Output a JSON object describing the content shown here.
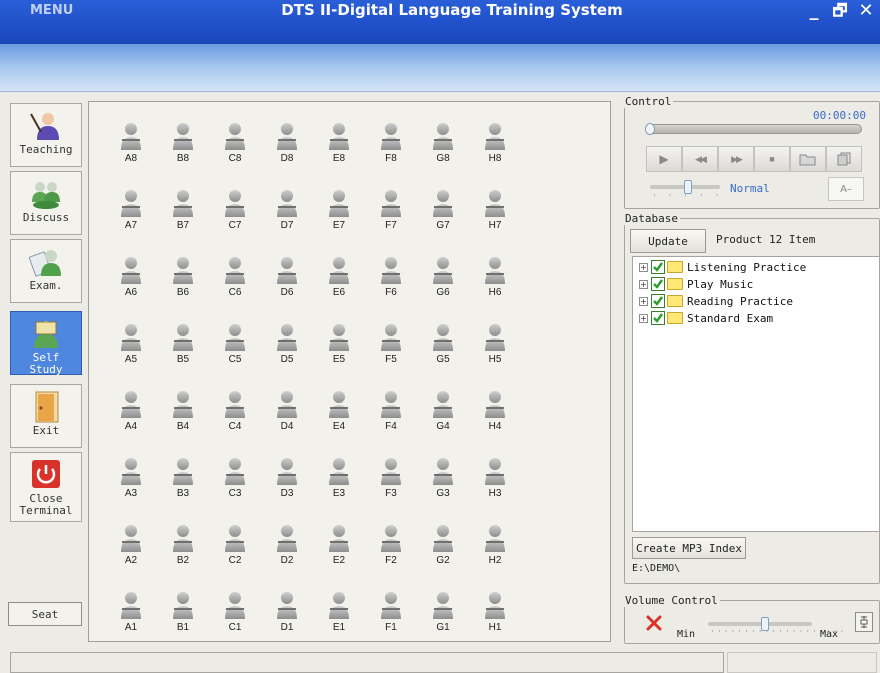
{
  "window": {
    "menu_label": "MENU",
    "title": "DTS II-Digital Language Training System",
    "controls": {
      "minimize": "_",
      "restore": "🗗",
      "close": "✕"
    }
  },
  "toolbar": {
    "items": [
      {
        "label": "Teaching",
        "icon": "teacher-icon",
        "active": false
      },
      {
        "label": "Discuss",
        "icon": "discuss-icon",
        "active": false
      },
      {
        "label": "Exam.",
        "icon": "exam-icon",
        "active": false
      },
      {
        "label": "Self\nStudy",
        "icon": "self-study-icon",
        "active": true
      },
      {
        "label": "Exit",
        "icon": "exit-door-icon",
        "active": false
      },
      {
        "label": "Close\nTerminal",
        "icon": "power-icon",
        "active": false
      }
    ],
    "seat_label": "Seat"
  },
  "seats": {
    "columns": [
      "A",
      "B",
      "C",
      "D",
      "E",
      "F",
      "G",
      "H"
    ],
    "rows": [
      8,
      7,
      6,
      5,
      4,
      3,
      2,
      1
    ]
  },
  "control": {
    "legend": "Control",
    "time": "00:00:00",
    "playback_progress": 0,
    "speed_label": "Normal",
    "font_button": "A–",
    "transport": [
      {
        "icon": "play-icon",
        "glyph": "▶"
      },
      {
        "icon": "rewind-icon",
        "glyph": "◀◀"
      },
      {
        "icon": "fast-forward-icon",
        "glyph": "▶▶"
      },
      {
        "icon": "stop-icon",
        "glyph": "■"
      },
      {
        "icon": "open-folder-icon",
        "glyph": "📂"
      },
      {
        "icon": "copy-icon",
        "glyph": "⧉"
      }
    ]
  },
  "database": {
    "legend": "Database",
    "update_label": "Update",
    "product_info": "Product 12 Item",
    "tree": [
      {
        "label": "Listening Practice",
        "checked": true
      },
      {
        "label": "Play Music",
        "checked": true
      },
      {
        "label": "Reading Practice",
        "checked": true
      },
      {
        "label": "Standard Exam",
        "checked": true
      }
    ],
    "create_mp3_label": "Create MP3 Index",
    "path": "E:\\DEMO\\"
  },
  "volume": {
    "legend": "Volume Control",
    "min_label": "Min",
    "max_label": "Max",
    "level": 0.55,
    "muted": true
  },
  "colors": {
    "titlebar": "#1f4fc9",
    "accent_blue": "#3a6cc8",
    "active_tool": "#4f86de",
    "mute_red": "#d8322b",
    "check_green": "#2aa12a",
    "folder_yellow": "#ffe875"
  }
}
